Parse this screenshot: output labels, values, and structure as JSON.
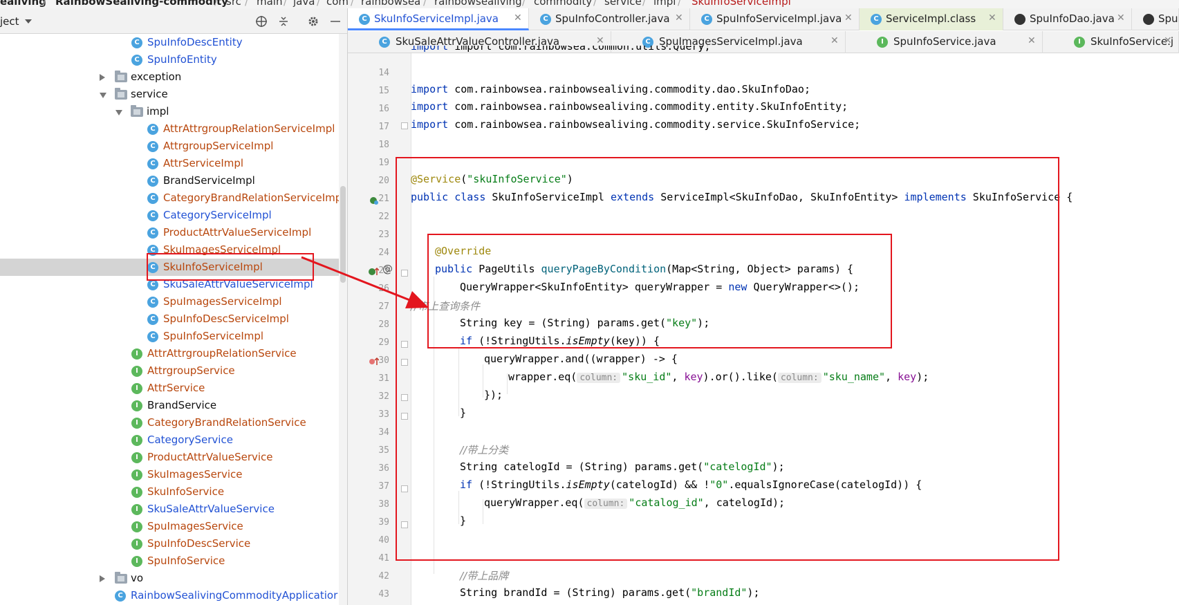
{
  "breadcrumb": [
    "ealiving",
    "RainbowSealiving-commodity",
    "src",
    "main",
    "java",
    "com",
    "rainbowsea",
    "rainbowsealiving",
    "commodity",
    "service",
    "impl",
    "SkuInfoServiceImpl"
  ],
  "project_panel": {
    "title": "ject",
    "icons": [
      "globe-icon",
      "collapse-icon",
      "gear-icon",
      "minimize-icon"
    ]
  },
  "tree": [
    {
      "label": "SpuInfoDescEntity",
      "icon": "C",
      "color": "blue"
    },
    {
      "label": "SpuInfoEntity",
      "icon": "C",
      "color": "blue"
    },
    {
      "label": "exception",
      "icon": "folder",
      "color": "black",
      "arrow": "right"
    },
    {
      "label": "service",
      "icon": "folder",
      "color": "black",
      "arrow": "down"
    },
    {
      "label": "impl",
      "icon": "folder",
      "color": "black",
      "arrow": "down"
    },
    {
      "label": "AttrAttrgroupRelationServiceImpl",
      "icon": "C",
      "color": "orange"
    },
    {
      "label": "AttrgroupServiceImpl",
      "icon": "C",
      "color": "orange"
    },
    {
      "label": "AttrServiceImpl",
      "icon": "C",
      "color": "orange"
    },
    {
      "label": "BrandServiceImpl",
      "icon": "C",
      "color": "black"
    },
    {
      "label": "CategoryBrandRelationServiceImp",
      "icon": "C",
      "color": "orange"
    },
    {
      "label": "CategoryServiceImpl",
      "icon": "C",
      "color": "blue"
    },
    {
      "label": "ProductAttrValueServiceImpl",
      "icon": "C",
      "color": "orange"
    },
    {
      "label": "SkuImagesServiceImpl",
      "icon": "C",
      "color": "orange"
    },
    {
      "label": "SkuInfoServiceImpl",
      "icon": "C",
      "color": "orange",
      "selected": true
    },
    {
      "label": "SkuSaleAttrValueServiceImpl",
      "icon": "C",
      "color": "blue"
    },
    {
      "label": "SpuImagesServiceImpl",
      "icon": "C",
      "color": "orange"
    },
    {
      "label": "SpuInfoDescServiceImpl",
      "icon": "C",
      "color": "orange"
    },
    {
      "label": "SpuInfoServiceImpl",
      "icon": "C",
      "color": "orange"
    },
    {
      "label": "AttrAttrgroupRelationService",
      "icon": "I",
      "color": "orange"
    },
    {
      "label": "AttrgroupService",
      "icon": "I",
      "color": "orange"
    },
    {
      "label": "AttrService",
      "icon": "I",
      "color": "orange"
    },
    {
      "label": "BrandService",
      "icon": "I",
      "color": "black"
    },
    {
      "label": "CategoryBrandRelationService",
      "icon": "I",
      "color": "orange"
    },
    {
      "label": "CategoryService",
      "icon": "I",
      "color": "blue"
    },
    {
      "label": "ProductAttrValueService",
      "icon": "I",
      "color": "orange"
    },
    {
      "label": "SkuImagesService",
      "icon": "I",
      "color": "orange"
    },
    {
      "label": "SkuInfoService",
      "icon": "I",
      "color": "orange"
    },
    {
      "label": "SkuSaleAttrValueService",
      "icon": "I",
      "color": "blue"
    },
    {
      "label": "SpuImagesService",
      "icon": "I",
      "color": "orange"
    },
    {
      "label": "SpuInfoDescService",
      "icon": "I",
      "color": "orange"
    },
    {
      "label": "SpuInfoService",
      "icon": "I",
      "color": "orange"
    },
    {
      "label": "vo",
      "icon": "folder",
      "color": "black",
      "arrow": "right"
    },
    {
      "label": "RainbowSealivingCommodityApplicatior",
      "icon": "app",
      "color": "blue"
    }
  ],
  "tabs_row1": [
    {
      "label": "SkuInfoServiceImpl.java",
      "active": true
    },
    {
      "label": "SpuInfoController.java"
    },
    {
      "label": "SpuInfoServiceImpl.java"
    },
    {
      "label": "ServiceImpl.class",
      "pinned": true
    },
    {
      "label": "SpuInfoDao.java"
    },
    {
      "label": "SpuInfo"
    }
  ],
  "tabs_row2": [
    {
      "label": "SkuSaleAttrValueController.java"
    },
    {
      "label": "SpuImagesServiceImpl.java"
    },
    {
      "label": "SpuInfoService.java"
    },
    {
      "label": "SkuInfoService.j"
    }
  ],
  "code": {
    "line_numbers": [
      "14",
      "15",
      "16",
      "17",
      "18",
      "19",
      "20",
      "21",
      "22",
      "23",
      "24",
      "25",
      "26",
      "27",
      "28",
      "29",
      "30",
      "31",
      "32",
      "33",
      "34",
      "35",
      "36",
      "37",
      "38",
      "39",
      "40",
      "41",
      "42",
      "43"
    ],
    "line13_partial": "import com.rainbowsea.common.utils.Query;",
    "import_kw": "import",
    "import15": " com.rainbowsea.rainbowsealiving.commodity.dao.SkuInfoDao;",
    "import16": " com.rainbowsea.rainbowsealiving.commodity.entity.SkuInfoEntity;",
    "import17": " com.rainbowsea.rainbowsealiving.commodity.service.SkuInfoService;",
    "service_ann": "@Service",
    "service_arg_open": "(",
    "service_name": "\"skuInfoService\"",
    "service_arg_close": ")",
    "class_kw": "public class",
    "class_name": " SkuInfoServiceImpl ",
    "extends_kw": "extends",
    "class_super": " ServiceImpl<SkuInfoDao, SkuInfoEntity> ",
    "implements_kw": "implements",
    "class_iface": " SkuInfoService {",
    "override": "@Override",
    "public_kw": "public",
    "method_ret": " PageUtils ",
    "method_name": "queryPageByCondition",
    "method_params": "(Map<String, Object> params) {",
    "qw_decl": "QueryWrapper<SkuInfoEntity> queryWrapper = ",
    "new_kw": "new",
    "qw_new": " QueryWrapper<>();",
    "comment27": "//带上查询条件",
    "key_decl": "String key = (String) params.get(",
    "key_str": "\"key\"",
    "close_semicolon": ");",
    "if_kw": "if",
    "if_open": " (!StringUtils.",
    "is_empty": "isEmpty",
    "if29_rest": "(key)) {",
    "and_call": "queryWrapper.and((wrapper) -> {",
    "eq_call": "wrapper.eq(",
    "hint_column": "column:",
    "sku_id": "\"sku_id\"",
    "comma": ", ",
    "key_ref": "key",
    "or_like": ").or().like(",
    "sku_name": "\"sku_name\"",
    "close32": "});",
    "close33": "}",
    "comment35": "//带上分类",
    "catelog_decl": "String catelogId = (String) params.get(",
    "catelog_str": "\"catelogId\"",
    "if37_rest1": "(catelogId) && !",
    "zero_str": "\"0\"",
    "if37_rest2": ".equalsIgnoreCase(catelogId)) {",
    "qw_eq": "queryWrapper.eq(",
    "catalog_id": "\"catalog_id\"",
    "catelog_tail": ", catelogId);",
    "close39": "}",
    "comment42": "//带上品牌",
    "brand_decl": "String brandId = (String) params.get(",
    "brand_str": "\"brandId\"",
    "brand_tail": ");"
  },
  "colors": {
    "annotation_box": "#e3161e",
    "active_tab_underline": "#4b88ff",
    "selected_row": "#d4d4d4"
  }
}
